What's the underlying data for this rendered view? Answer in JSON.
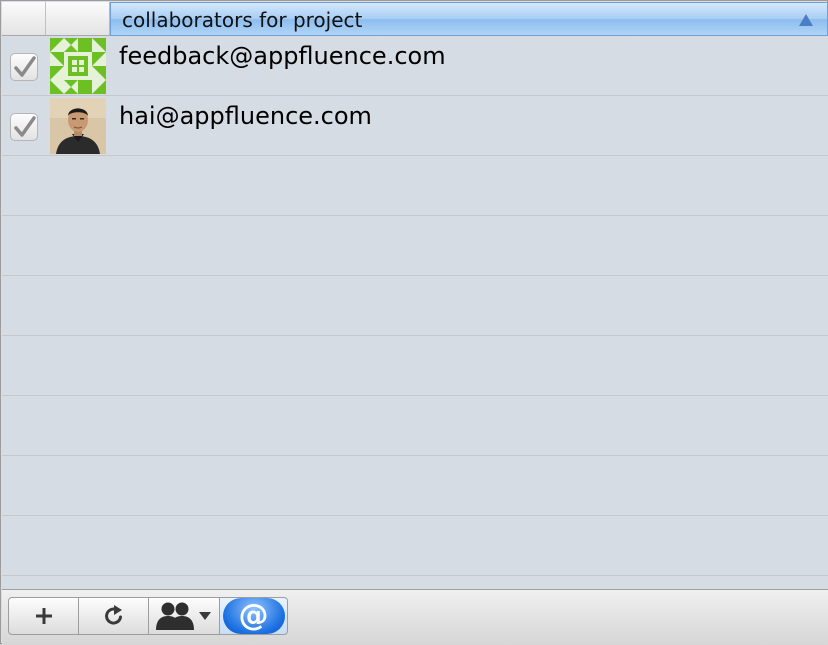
{
  "header": {
    "column_title": "collaborators for project",
    "sort_icon": "sort-ascending-triangle-icon",
    "accent_color": "#8cbdef"
  },
  "collaborators": [
    {
      "email": "feedback@appfluence.com",
      "checked": true,
      "avatar": "green-identicon"
    },
    {
      "email": "hai@appfluence.com",
      "checked": true,
      "avatar": "person-photo"
    }
  ],
  "toolbar": {
    "buttons": [
      {
        "icon": "plus-icon"
      },
      {
        "icon": "refresh-icon"
      },
      {
        "icon": "group-dropdown-icon"
      },
      {
        "icon": "at-sign-icon",
        "glyph": "@"
      }
    ]
  }
}
